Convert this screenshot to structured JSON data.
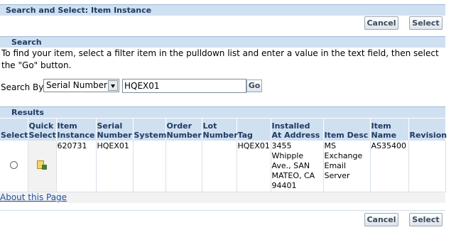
{
  "page": {
    "title": "Search and Select: Item Instance"
  },
  "top_buttons": {
    "cancel": "Cancel",
    "select": "Select"
  },
  "search": {
    "header": "Search",
    "instructions": "To find your item, select a filter item in the pulldown list and enter a value in the text field, then select the \"Go\" button.",
    "search_by_label": "Search By",
    "filter_selected": "Serial Number",
    "value": "HQEX01",
    "go": "Go"
  },
  "results": {
    "header": "Results",
    "columns": [
      "Select",
      "Quick Select",
      "Item Instance",
      "Serial Number",
      "System",
      "Order Number",
      "Lot Number",
      "Tag",
      "Installed At Address",
      "Item Desc",
      "Item Name",
      "Revision"
    ],
    "rows": [
      {
        "item_instance": "620731",
        "serial_number": "HQEX01",
        "system": "",
        "order_number": "",
        "lot_number": "",
        "tag": "HQEX01",
        "address": "3455 Whipple Ave., SAN MATEO, CA 94401",
        "item_desc": "MS Exchange Email Server",
        "item_name": "AS35400",
        "revision": ""
      }
    ]
  },
  "about_link": "About this Page",
  "bottom_buttons": {
    "cancel": "Cancel",
    "select": "Select"
  },
  "icons": {
    "quick_select": "quick-select-icon",
    "dropdown": "chevron-down-icon"
  }
}
